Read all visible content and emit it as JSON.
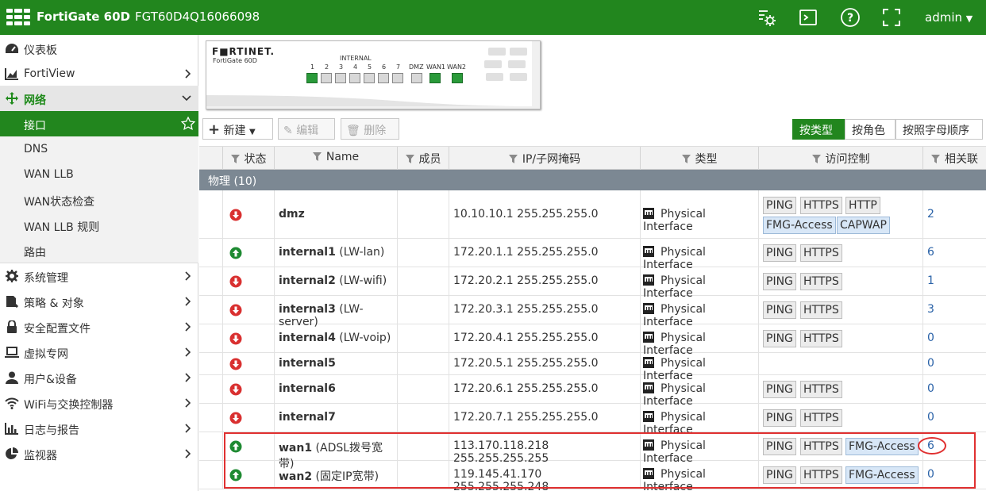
{
  "header": {
    "app_title": "FortiGate 60D",
    "serial": "FGT60D4Q16066098",
    "user": "admin"
  },
  "sidebar": {
    "items": [
      {
        "label": "仪表板",
        "icon": "dashboard-icon"
      },
      {
        "label": "FortiView",
        "icon": "chart-icon"
      },
      {
        "label": "网络",
        "icon": "network-move-icon"
      },
      {
        "label": "接口"
      },
      {
        "label": "DNS"
      },
      {
        "label": "WAN LLB"
      },
      {
        "label": "WAN状态检查"
      },
      {
        "label": "WAN LLB 规则"
      },
      {
        "label": "路由"
      },
      {
        "label": "系统管理",
        "icon": "gear-icon"
      },
      {
        "label": "策略 & 对象",
        "icon": "policy-icon"
      },
      {
        "label": "安全配置文件",
        "icon": "lock-icon"
      },
      {
        "label": "虚拟专网",
        "icon": "laptop-icon"
      },
      {
        "label": "用户&设备",
        "icon": "user-icon"
      },
      {
        "label": "WiFi与交换控制器",
        "icon": "wifi-icon"
      },
      {
        "label": "日志与报告",
        "icon": "bar-chart-icon"
      },
      {
        "label": "监视器",
        "icon": "pie-icon"
      }
    ]
  },
  "device": {
    "brand": "F■RTINET.",
    "model": "FortiGate 60D",
    "internal_label": "INTERNAL",
    "ports": [
      {
        "label": "1",
        "up": true
      },
      {
        "label": "2",
        "up": false
      },
      {
        "label": "3",
        "up": false
      },
      {
        "label": "4",
        "up": false
      },
      {
        "label": "5",
        "up": false
      },
      {
        "label": "6",
        "up": false
      },
      {
        "label": "7",
        "up": false
      },
      {
        "label": "DMZ",
        "up": false
      },
      {
        "label": "WAN1",
        "up": true
      },
      {
        "label": "WAN2",
        "up": true
      }
    ]
  },
  "toolbar": {
    "new_label": "新建",
    "edit_label": "编辑",
    "delete_label": "删除",
    "view_by_type": "按类型",
    "view_by_role": "按角色",
    "view_alpha": "按照字母顺序"
  },
  "table": {
    "columns": [
      "状态",
      "Name",
      "成员",
      "IP/子网掩码",
      "类型",
      "访问控制",
      "相关联"
    ],
    "group_label": "物理 (10)",
    "rows": [
      {
        "status": "down",
        "name": "dmz",
        "alias": "",
        "ip": "10.10.10.1 255.255.255.0",
        "type": "Physical Interface",
        "access": [
          "PING",
          "HTTPS",
          "HTTP",
          "FMG-Access",
          "CAPWAP"
        ],
        "ref": "2"
      },
      {
        "status": "up",
        "name": "internal1",
        "alias": " (LW-lan)",
        "ip": "172.20.1.1 255.255.255.0",
        "type": "Physical Interface",
        "access": [
          "PING",
          "HTTPS"
        ],
        "ref": "6"
      },
      {
        "status": "down",
        "name": "internal2",
        "alias": " (LW-wifi)",
        "ip": "172.20.2.1 255.255.255.0",
        "type": "Physical Interface",
        "access": [
          "PING",
          "HTTPS"
        ],
        "ref": "1"
      },
      {
        "status": "down",
        "name": "internal3",
        "alias": " (LW-server)",
        "ip": "172.20.3.1 255.255.255.0",
        "type": "Physical Interface",
        "access": [
          "PING",
          "HTTPS"
        ],
        "ref": "3"
      },
      {
        "status": "down",
        "name": "internal4",
        "alias": " (LW-voip)",
        "ip": "172.20.4.1 255.255.255.0",
        "type": "Physical Interface",
        "access": [
          "PING",
          "HTTPS"
        ],
        "ref": "0"
      },
      {
        "status": "down",
        "name": "internal5",
        "alias": "",
        "ip": "172.20.5.1 255.255.255.0",
        "type": "Physical Interface",
        "access": [],
        "ref": "0"
      },
      {
        "status": "down",
        "name": "internal6",
        "alias": "",
        "ip": "172.20.6.1 255.255.255.0",
        "type": "Physical Interface",
        "access": [
          "PING",
          "HTTPS"
        ],
        "ref": "0"
      },
      {
        "status": "down",
        "name": "internal7",
        "alias": "",
        "ip": "172.20.7.1 255.255.255.0",
        "type": "Physical Interface",
        "access": [
          "PING",
          "HTTPS"
        ],
        "ref": "0"
      },
      {
        "status": "up",
        "name": "wan1",
        "alias": " (ADSL拨号宽带)",
        "ip": "113.170.118.218 255.255.255.255",
        "type": "Physical Interface",
        "access": [
          "PING",
          "HTTPS",
          "FMG-Access"
        ],
        "ref": "6"
      },
      {
        "status": "up",
        "name": "wan2",
        "alias": " (固定IP宽带)",
        "ip": "119.145.41.170 255.255.255.248",
        "type": "Physical Interface",
        "access": [
          "PING",
          "HTTPS",
          "FMG-Access"
        ],
        "ref": "0"
      }
    ]
  },
  "colors": {
    "brand_green": "#22861e",
    "status_up": "#1e8a32",
    "status_down": "#d93030",
    "group_row": "#7c8893",
    "annotation_red": "#e03030"
  }
}
